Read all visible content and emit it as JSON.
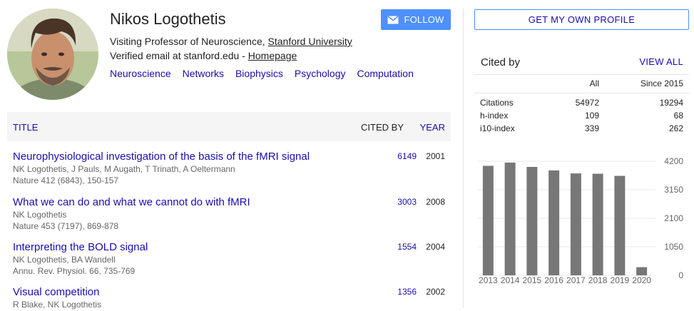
{
  "profile": {
    "name": "Nikos Logothetis",
    "affiliation_prefix": "Visiting Professor of Neuroscience, ",
    "affiliation_link": "Stanford University",
    "email_prefix": "Verified email at stanford.edu - ",
    "homepage": "Homepage",
    "interests": [
      "Neuroscience",
      "Networks",
      "Biophysics",
      "Psychology",
      "Computation"
    ],
    "follow_label": "FOLLOW"
  },
  "table": {
    "col_title": "TITLE",
    "col_cited": "CITED BY",
    "col_year": "YEAR",
    "articles": [
      {
        "title": "Neurophysiological investigation of the basis of the fMRI signal",
        "authors": "NK Logothetis, J Pauls, M Augath, T Trinath, A Oeltermann",
        "venue": "Nature 412 (6843), 150-157",
        "cited": "6149",
        "year": "2001"
      },
      {
        "title": "What we can do and what we cannot do with fMRI",
        "authors": "NK Logothetis",
        "venue": "Nature 453 (7197), 869-878",
        "cited": "3003",
        "year": "2008"
      },
      {
        "title": "Interpreting the BOLD signal",
        "authors": "NK Logothetis, BA Wandell",
        "venue": "Annu. Rev. Physiol. 66, 735-769",
        "cited": "1554",
        "year": "2004"
      },
      {
        "title": "Visual competition",
        "authors": "R Blake, NK Logothetis",
        "venue": "",
        "cited": "1356",
        "year": "2002"
      }
    ]
  },
  "sidebar": {
    "own_profile_label": "GET MY OWN PROFILE",
    "cited_by_label": "Cited by",
    "view_all_label": "VIEW ALL",
    "col_all": "All",
    "col_since": "Since 2015",
    "metrics": [
      {
        "label": "Citations",
        "all": "54972",
        "since": "19294"
      },
      {
        "label": "h-index",
        "all": "109",
        "since": "68"
      },
      {
        "label": "i10-index",
        "all": "339",
        "since": "262"
      }
    ]
  },
  "chart_data": {
    "type": "bar",
    "categories": [
      "2013",
      "2014",
      "2015",
      "2016",
      "2017",
      "2018",
      "2019",
      "2020"
    ],
    "values": [
      4030,
      4150,
      3990,
      3860,
      3750,
      3740,
      3660,
      300
    ],
    "ylim": [
      0,
      4200
    ],
    "y_ticks": [
      "0",
      "1050",
      "2100",
      "3150",
      "4200"
    ],
    "bar_color": "#777777",
    "grid": true
  },
  "colors": {
    "link": "#1a0dab",
    "button": "#4d90fe",
    "header_bg": "#f5f5f5"
  }
}
